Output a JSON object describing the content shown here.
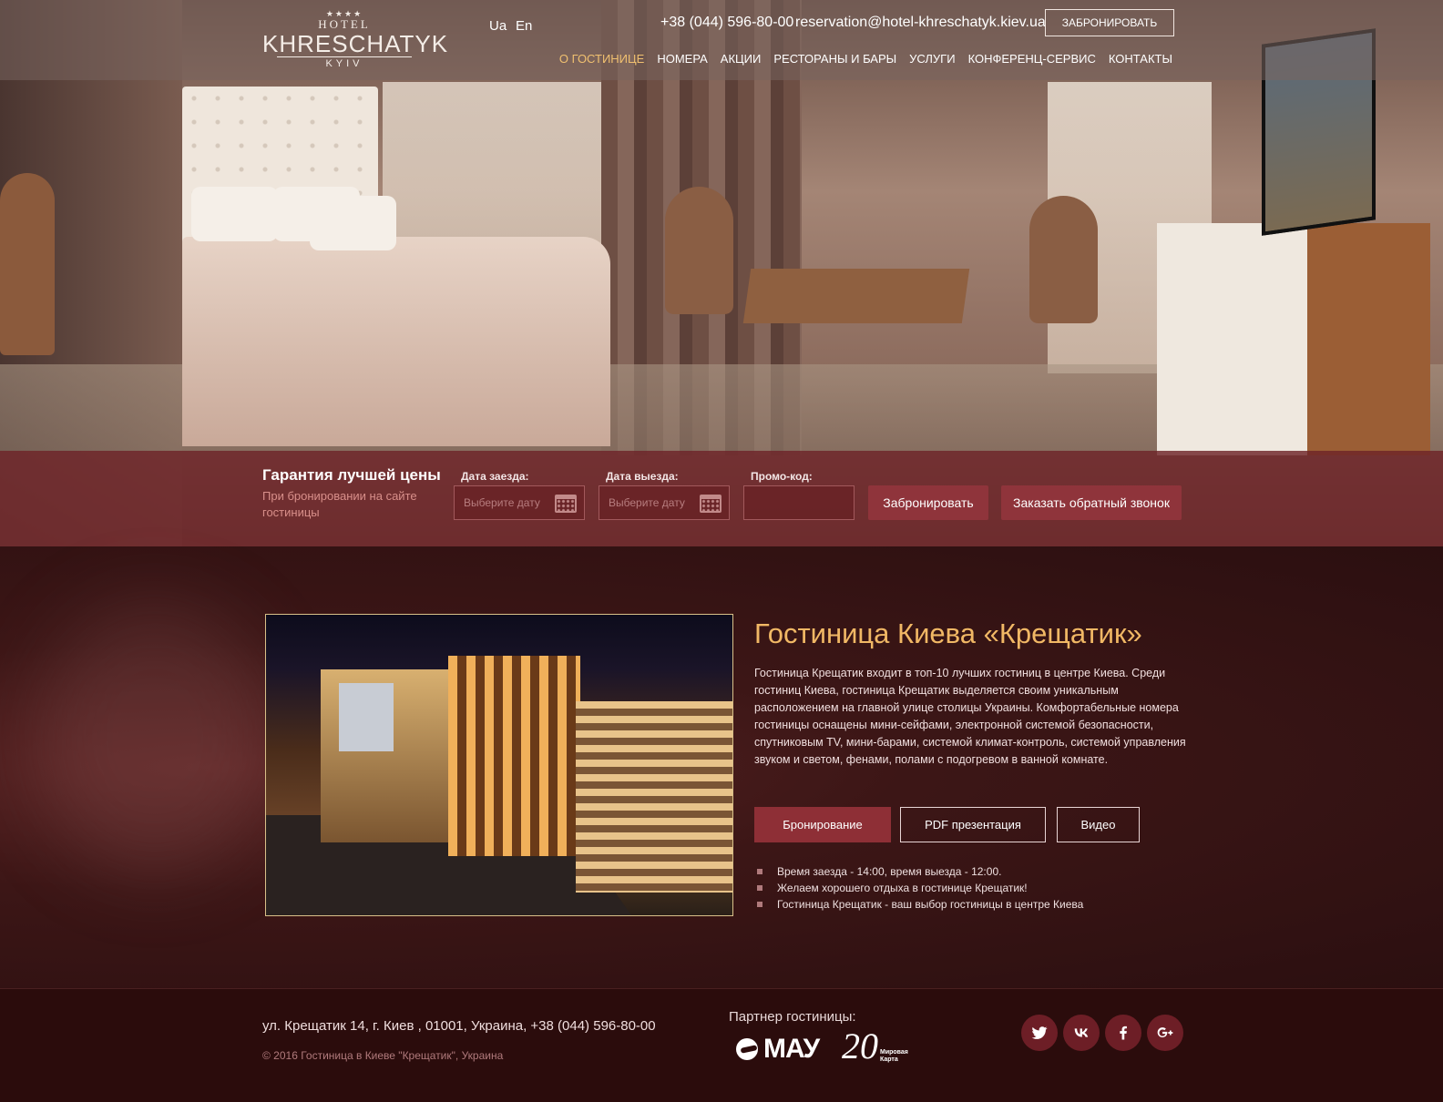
{
  "header": {
    "logo": {
      "stars": "★★★★",
      "hotel": "HOTEL",
      "name": "KHRESCHATYK",
      "city": "KYIV"
    },
    "languages": [
      "Ua",
      "En"
    ],
    "phone": "+38 (044) 596-80-00",
    "email": "reservation@hotel-khreschatyk.kiev.ua",
    "book_button": "ЗАБРОНИРОВАТЬ",
    "nav": [
      "О ГОСТИНИЦЕ",
      "НОМЕРА",
      "АКЦИИ",
      "РЕСТОРАНЫ И БАРЫ",
      "УСЛУГИ",
      "КОНФЕРЕНЦ-СЕРВИС",
      "КОНТАКТЫ"
    ],
    "nav_active": "О ГОСТИНИЦЕ"
  },
  "booking": {
    "title": "Гарантия лучшей цены",
    "subtitle": "При бронировании на сайте гостиницы",
    "checkin_label": "Дата заезда:",
    "checkin_placeholder": "Выберите дату",
    "checkout_label": "Дата выезда:",
    "checkout_placeholder": "Выберите дату",
    "promo_label": "Промо-код:",
    "promo_value": "",
    "book_button": "Забронировать",
    "callback_button": "Заказать обратный звонок"
  },
  "content": {
    "title": "Гостиница Киева «Крещатик»",
    "description": "Гостиница Крещатик входит в топ-10 лучших гостиниц в центре Киева. Среди гостиниц Киева, гостиница Крещатик выделяется своим уникальным расположением на главной улице столицы Украины. Комфортабельные номера гостиницы оснащены мини-сейфами, электронной системой безопасности, спутниковым TV, мини-барами, системой климат-контроль, системой управления звуком и светом, фенами, полами с подогревом в ванной комнате.",
    "buttons": {
      "booking": "Бронирование",
      "pdf": "PDF презентация",
      "video": "Видео"
    },
    "bullets": [
      "Время заезда - 14:00, время выезда - 12:00.",
      "Желаем хорошего отдыха в гостинице Крещатик!",
      "Гостиница Крещатик - ваш выбор гостиницы в центре Киева"
    ]
  },
  "footer": {
    "address": "ул. Крещатик 14, г. Киев , 01001, Украина, +38 (044) 596-80-00",
    "copyright": "© 2016 Гостиница в Киеве \"Крещатик\", Украина",
    "partner_label": "Партнер гостиницы:",
    "partners": {
      "mau": "МАУ",
      "map_number": "20",
      "map_name": "Мировая Карта"
    },
    "social": [
      "twitter-icon",
      "vk-icon",
      "facebook-icon",
      "google-plus-icon"
    ]
  },
  "colors": {
    "accent": "#8e2f36",
    "title_gold": "#f1b865",
    "nav_active": "#f0c070",
    "background": "#2b0f10"
  }
}
